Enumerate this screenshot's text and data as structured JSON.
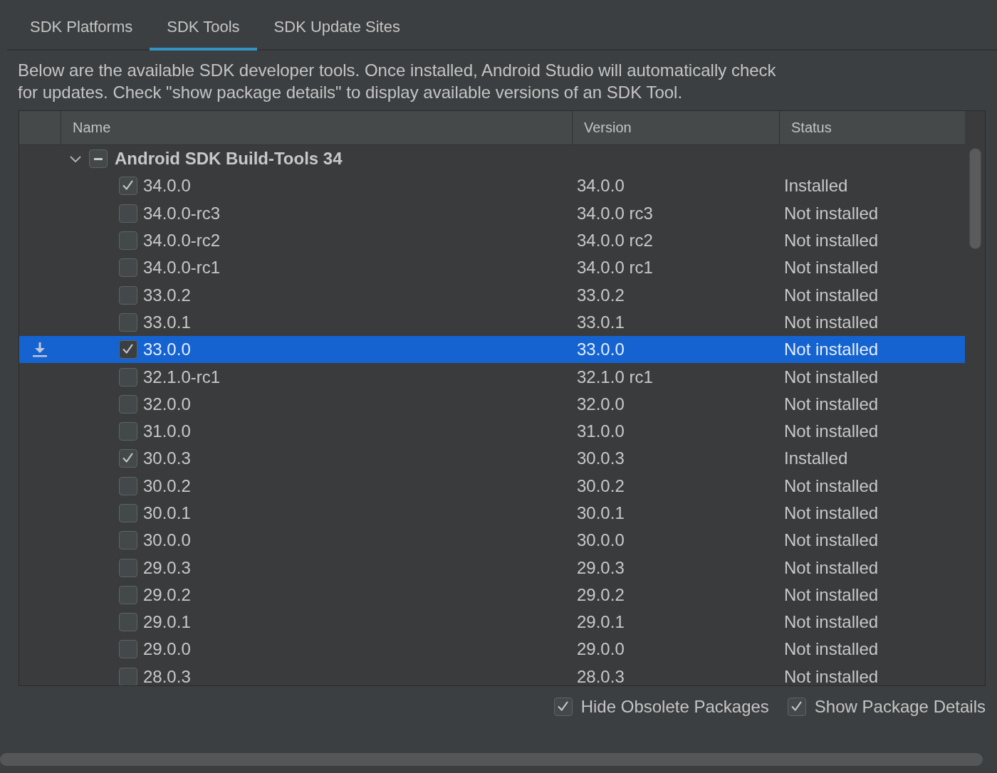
{
  "tabs": [
    {
      "label": "SDK Platforms",
      "selected": false
    },
    {
      "label": "SDK Tools",
      "selected": true
    },
    {
      "label": "SDK Update Sites",
      "selected": false
    }
  ],
  "description": "Below are the available SDK developer tools. Once installed, Android Studio will automatically check for updates. Check \"show package details\" to display available versions of an SDK Tool.",
  "table": {
    "columns": [
      "Name",
      "Version",
      "Status"
    ],
    "group": {
      "name": "Android SDK Build-Tools 34",
      "expanded": true,
      "partial": true
    },
    "rows": [
      {
        "name": "34.0.0",
        "version": "34.0.0",
        "status": "Installed",
        "checked": true,
        "selected": false,
        "pending": false
      },
      {
        "name": "34.0.0-rc3",
        "version": "34.0.0 rc3",
        "status": "Not installed",
        "checked": false,
        "selected": false,
        "pending": false
      },
      {
        "name": "34.0.0-rc2",
        "version": "34.0.0 rc2",
        "status": "Not installed",
        "checked": false,
        "selected": false,
        "pending": false
      },
      {
        "name": "34.0.0-rc1",
        "version": "34.0.0 rc1",
        "status": "Not installed",
        "checked": false,
        "selected": false,
        "pending": false
      },
      {
        "name": "33.0.2",
        "version": "33.0.2",
        "status": "Not installed",
        "checked": false,
        "selected": false,
        "pending": false
      },
      {
        "name": "33.0.1",
        "version": "33.0.1",
        "status": "Not installed",
        "checked": false,
        "selected": false,
        "pending": false
      },
      {
        "name": "33.0.0",
        "version": "33.0.0",
        "status": "Not installed",
        "checked": true,
        "selected": true,
        "pending": true
      },
      {
        "name": "32.1.0-rc1",
        "version": "32.1.0 rc1",
        "status": "Not installed",
        "checked": false,
        "selected": false,
        "pending": false
      },
      {
        "name": "32.0.0",
        "version": "32.0.0",
        "status": "Not installed",
        "checked": false,
        "selected": false,
        "pending": false
      },
      {
        "name": "31.0.0",
        "version": "31.0.0",
        "status": "Not installed",
        "checked": false,
        "selected": false,
        "pending": false
      },
      {
        "name": "30.0.3",
        "version": "30.0.3",
        "status": "Installed",
        "checked": true,
        "selected": false,
        "pending": false
      },
      {
        "name": "30.0.2",
        "version": "30.0.2",
        "status": "Not installed",
        "checked": false,
        "selected": false,
        "pending": false
      },
      {
        "name": "30.0.1",
        "version": "30.0.1",
        "status": "Not installed",
        "checked": false,
        "selected": false,
        "pending": false
      },
      {
        "name": "30.0.0",
        "version": "30.0.0",
        "status": "Not installed",
        "checked": false,
        "selected": false,
        "pending": false
      },
      {
        "name": "29.0.3",
        "version": "29.0.3",
        "status": "Not installed",
        "checked": false,
        "selected": false,
        "pending": false
      },
      {
        "name": "29.0.2",
        "version": "29.0.2",
        "status": "Not installed",
        "checked": false,
        "selected": false,
        "pending": false
      },
      {
        "name": "29.0.1",
        "version": "29.0.1",
        "status": "Not installed",
        "checked": false,
        "selected": false,
        "pending": false
      },
      {
        "name": "29.0.0",
        "version": "29.0.0",
        "status": "Not installed",
        "checked": false,
        "selected": false,
        "pending": false
      },
      {
        "name": "28.0.3",
        "version": "28.0.3",
        "status": "Not installed",
        "checked": false,
        "selected": false,
        "pending": false
      }
    ]
  },
  "options": [
    {
      "label": "Hide Obsolete Packages",
      "checked": true
    },
    {
      "label": "Show Package Details",
      "checked": true
    }
  ]
}
